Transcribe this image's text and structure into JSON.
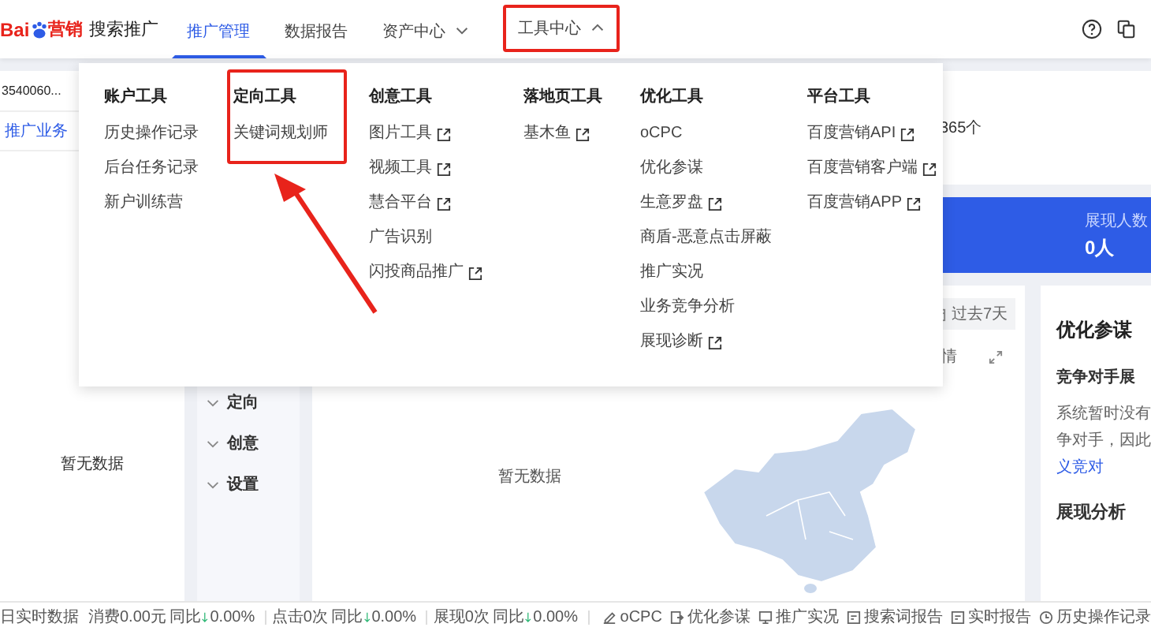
{
  "top_nav": {
    "logo": {
      "brand": "Bai",
      "suffix": "营销"
    },
    "product": "搜索推广",
    "items": [
      {
        "label": "推广管理",
        "kind": "plain",
        "selected": true,
        "highlighted": false
      },
      {
        "label": "数据报告",
        "kind": "plain",
        "selected": false,
        "highlighted": false
      },
      {
        "label": "资产中心",
        "kind": "menu",
        "selected": false,
        "expanded": false,
        "highlighted": false
      },
      {
        "label": "工具中心",
        "kind": "menu",
        "selected": false,
        "expanded": true,
        "highlighted": true
      }
    ]
  },
  "dropdown": {
    "annotation_arrow": true,
    "groups": [
      {
        "title": "账户工具",
        "highlighted": false,
        "items": [
          {
            "label": "历史操作记录",
            "external": false
          },
          {
            "label": "后台任务记录",
            "external": false
          },
          {
            "label": "新户训练营",
            "external": false
          }
        ]
      },
      {
        "title": "定向工具",
        "highlighted": true,
        "items": [
          {
            "label": "关键词规划师",
            "external": false
          }
        ]
      },
      {
        "title": "创意工具",
        "highlighted": false,
        "items": [
          {
            "label": "图片工具",
            "external": true
          },
          {
            "label": "视频工具",
            "external": true
          },
          {
            "label": "慧合平台",
            "external": true
          },
          {
            "label": "广告识别",
            "external": false
          },
          {
            "label": "闪投商品推广",
            "external": true
          }
        ]
      },
      {
        "title": "落地页工具",
        "highlighted": false,
        "items": [
          {
            "label": "基木鱼",
            "external": true
          }
        ]
      },
      {
        "title": "优化工具",
        "highlighted": false,
        "items": [
          {
            "label": "oCPC",
            "external": false
          },
          {
            "label": "优化参谋",
            "external": false
          },
          {
            "label": "生意罗盘",
            "external": true
          },
          {
            "label": "商盾-恶意点击屏蔽",
            "external": false
          },
          {
            "label": "推广实况",
            "external": false
          },
          {
            "label": "业务竞争分析",
            "external": false
          },
          {
            "label": "展现诊断",
            "external": true
          }
        ]
      },
      {
        "title": "平台工具",
        "highlighted": false,
        "items": [
          {
            "label": "百度营销API",
            "external": true
          },
          {
            "label": "百度营销客户端",
            "external": true
          },
          {
            "label": "百度营销APP",
            "external": true
          }
        ]
      }
    ]
  },
  "left_panel": {
    "account": "3540060...",
    "tab": "推广业务",
    "empty": "暂无数据"
  },
  "filter_panel": {
    "sections": [
      {
        "label": "定向",
        "expanded": false
      },
      {
        "label": "创意",
        "expanded": false
      },
      {
        "label": "设置",
        "expanded": false
      }
    ]
  },
  "main": {
    "count": "365个",
    "stat": {
      "label": "展现人数",
      "value": "0人"
    },
    "date_button": "过去7天",
    "details_link": "情",
    "empty": "暂无数据"
  },
  "right_panel": {
    "title": "优化参谋",
    "subtitle": "竞争对手展",
    "lines": [
      "系统暂时没有",
      "争对手，因此"
    ],
    "link": "义竞对",
    "section": "展现分析"
  },
  "status_bar": {
    "title": "日实时数据",
    "metrics": [
      {
        "label": "消费0.00元",
        "compare": "同比",
        "change": "0.00%"
      },
      {
        "label": "点击0次",
        "compare": "同比",
        "change": "0.00%"
      },
      {
        "label": "展现0次",
        "compare": "同比",
        "change": "0.00%"
      }
    ],
    "shortcuts": [
      {
        "label": "oCPC"
      },
      {
        "label": "优化参谋"
      },
      {
        "label": "推广实况"
      },
      {
        "label": "搜索词报告"
      },
      {
        "label": "实时报告"
      },
      {
        "label": "历史操作记录"
      }
    ]
  }
}
